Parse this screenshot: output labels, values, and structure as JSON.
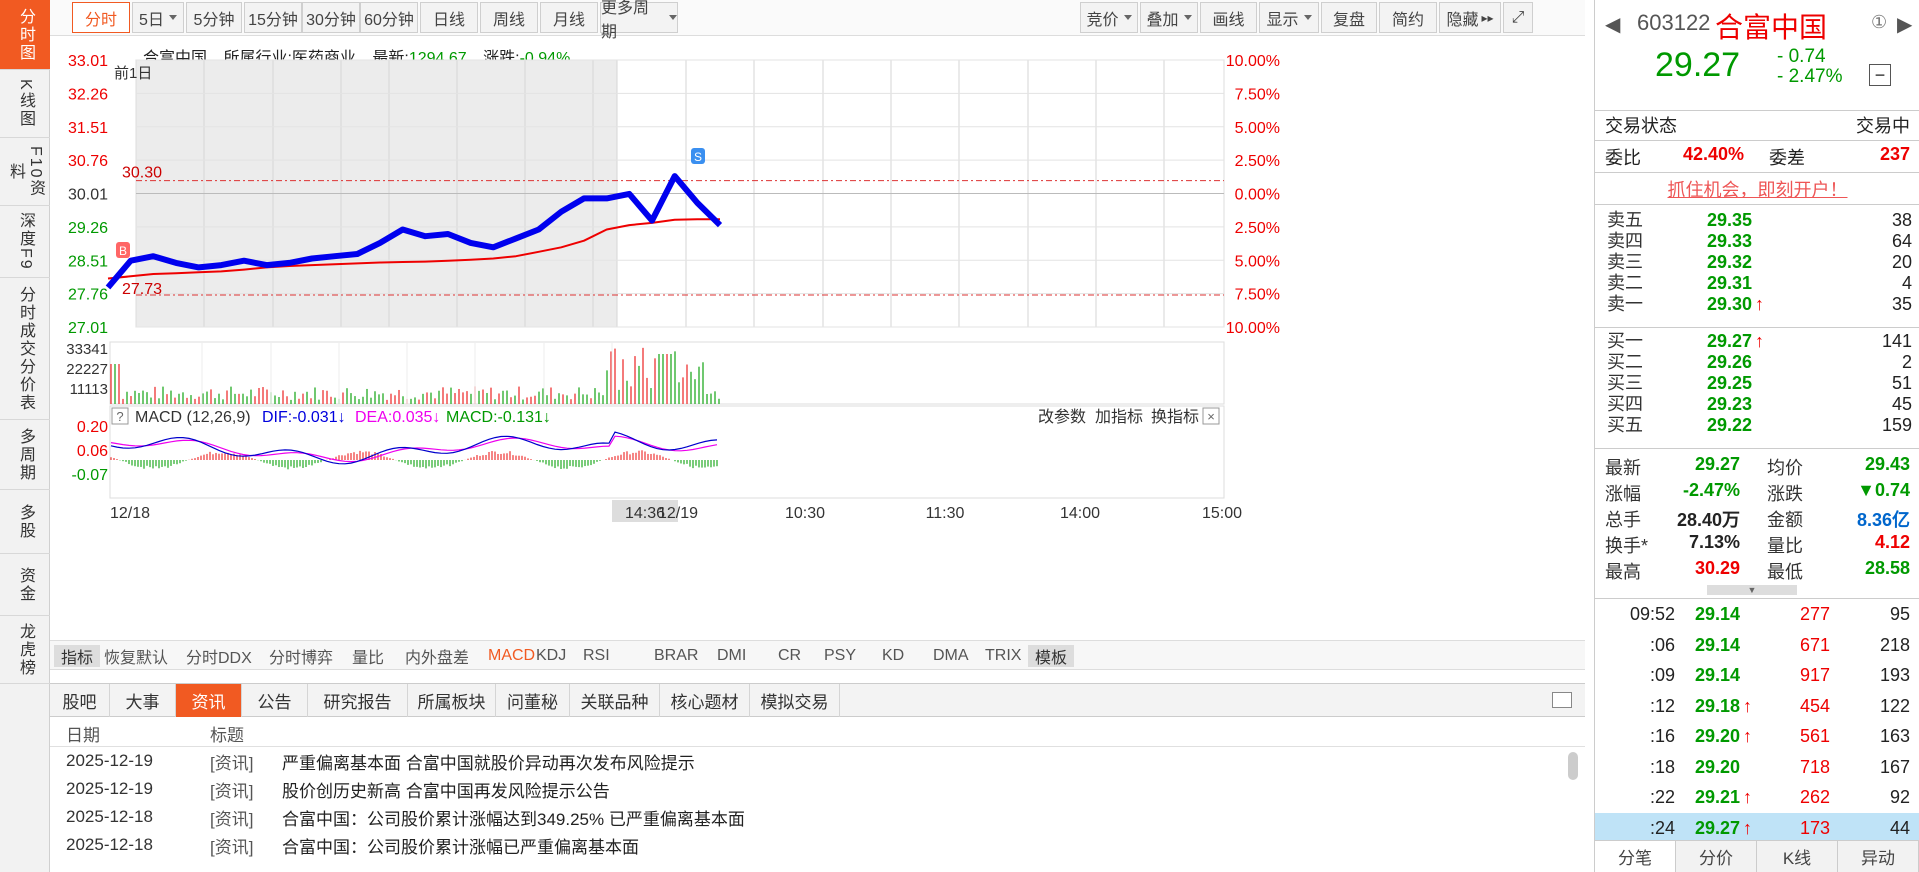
{
  "left_nav": [
    {
      "label": "分时图",
      "active": true
    },
    {
      "label": "K线图",
      "active": false
    },
    {
      "label": "F10资料",
      "active": false
    },
    {
      "label": "深度F9",
      "active": false
    },
    {
      "label": "分时成交分价表",
      "active": false
    },
    {
      "label": "多周期",
      "active": false
    },
    {
      "label": "多股",
      "active": false
    },
    {
      "label": "资金",
      "active": false
    },
    {
      "label": "龙虎榜",
      "active": false
    }
  ],
  "toolbar": {
    "period_buttons": [
      "分时",
      "5日",
      "5分钟",
      "15分钟",
      "30分钟",
      "60分钟",
      "日线",
      "周线",
      "月线",
      "更多周期"
    ],
    "right_buttons": [
      "竞价",
      "叠加",
      "画线",
      "显示",
      "复盘",
      "简约",
      "隐藏"
    ]
  },
  "info": {
    "name": "合富中国",
    "industry_label": "所属行业:",
    "industry": "医药商业",
    "latest_label": "最新:",
    "latest": "1294.67",
    "change_label": "涨跌:",
    "change": "-0.94%"
  },
  "price_chart": {
    "prev_label": "前1日",
    "y_ticks": [
      "33.01",
      "32.26",
      "31.51",
      "30.76",
      "30.01",
      "29.26",
      "28.51",
      "27.76",
      "27.01"
    ],
    "pct_ticks": [
      "10.00%",
      "7.50%",
      "5.00%",
      "2.50%",
      "0.00%",
      "2.50%",
      "5.00%",
      "7.50%",
      "10.00%"
    ],
    "high_marker": "30.30",
    "low_marker": "27.73",
    "buy_mark": "B",
    "sell_mark": "S"
  },
  "chart_data": {
    "type": "line",
    "title": "",
    "x_labels": [
      "12/18",
      "14:36",
      "12/19",
      "10:30",
      "11:30",
      "14:00",
      "15:00"
    ],
    "ylim": [
      27.01,
      33.01
    ],
    "prev_close": 30.01,
    "series": [
      {
        "name": "",
        "values": [
          27.9,
          28.5,
          28.6,
          28.45,
          28.35,
          28.4,
          28.5,
          28.4,
          28.45,
          28.55,
          28.6,
          28.65,
          28.9,
          29.2,
          29.05,
          29.1,
          28.9,
          28.8,
          29.0,
          29.2,
          29.6,
          29.9,
          29.9,
          30.0,
          29.4,
          30.4,
          29.8,
          29.3
        ]
      },
      {
        "name": "",
        "values": [
          28.1,
          28.15,
          28.2,
          28.22,
          28.24,
          28.26,
          28.3,
          28.35,
          28.38,
          28.4,
          28.42,
          28.44,
          28.46,
          28.47,
          28.48,
          28.5,
          28.52,
          28.55,
          28.6,
          28.7,
          28.8,
          28.95,
          29.2,
          29.3,
          29.35,
          29.42,
          29.43,
          29.43
        ]
      }
    ],
    "volume": {
      "y_ticks": [
        "33341",
        "22227",
        "11113"
      ]
    },
    "macd": {
      "title": "MACD (12,26,9)",
      "dif": "DIF:-0.031↓",
      "dea": "DEA:0.035↓",
      "macd": "MACD:-0.131↓",
      "y_ticks": [
        "0.20",
        "0.06",
        "-0.07"
      ],
      "buttons": [
        "改参数",
        "加指标",
        "换指标"
      ]
    }
  },
  "indicator_tabs": [
    "指标",
    "恢复默认",
    "分时DDX",
    "分时博弈",
    "量比",
    "内外盘差",
    "MACD",
    "KDJ",
    "RSI",
    "BRAR",
    "DMI",
    "CR",
    "PSY",
    "KD",
    "DMA",
    "TRIX",
    "模板"
  ],
  "news_tabs": [
    "股吧",
    "大事",
    "资讯",
    "公告",
    "研究报告",
    "所属板块",
    "问董秘",
    "关联品种",
    "核心题材",
    "模拟交易"
  ],
  "news_header": {
    "date": "日期",
    "title": "标题"
  },
  "news": [
    {
      "date": "2025-12-19",
      "tag": "[资讯]",
      "title": "严重偏离基本面 合富中国就股价异动再次发布风险提示"
    },
    {
      "date": "2025-12-19",
      "tag": "[资讯]",
      "title": "股价创历史新高 合富中国再发风险提示公告"
    },
    {
      "date": "2025-12-18",
      "tag": "[资讯]",
      "title": "合富中国：公司股价累计涨幅达到349.25% 已严重偏离基本面"
    },
    {
      "date": "2025-12-18",
      "tag": "[资讯]",
      "title": "合富中国：公司股价累计涨幅已严重偏离基本面"
    }
  ],
  "quote": {
    "code": "603122",
    "name": "合富中国",
    "price": "29.27",
    "change": "- 0.74",
    "change_pct": "- 2.47%",
    "status_label": "交易状态",
    "status": "交易中",
    "wb_label": "委比",
    "wb": "42.40%",
    "wc_label": "委差",
    "wc": "237",
    "promo": "抓住机会，即刻开户！",
    "sell": [
      {
        "label": "卖五",
        "price": "29.35",
        "vol": "38"
      },
      {
        "label": "卖四",
        "price": "29.33",
        "vol": "64"
      },
      {
        "label": "卖三",
        "price": "29.32",
        "vol": "20"
      },
      {
        "label": "卖二",
        "price": "29.31",
        "vol": "4"
      },
      {
        "label": "卖一",
        "price": "29.30",
        "vol": "35",
        "up": true
      }
    ],
    "buy": [
      {
        "label": "买一",
        "price": "29.27",
        "vol": "141",
        "up": true
      },
      {
        "label": "买二",
        "price": "29.26",
        "vol": "2"
      },
      {
        "label": "买三",
        "price": "29.25",
        "vol": "51"
      },
      {
        "label": "买四",
        "price": "29.23",
        "vol": "45"
      },
      {
        "label": "买五",
        "price": "29.22",
        "vol": "159"
      }
    ],
    "stats": [
      {
        "l1": "最新",
        "v1": "29.27",
        "c1": "green",
        "l2": "均价",
        "v2": "29.43",
        "c2": "green"
      },
      {
        "l1": "涨幅",
        "v1": "-2.47%",
        "c1": "green",
        "l2": "涨跌",
        "v2": "▼0.74",
        "c2": "green"
      },
      {
        "l1": "总手",
        "v1": "28.40万",
        "c1": "dark",
        "l2": "金额",
        "v2": "8.36亿",
        "c2": "blue"
      },
      {
        "l1": "换手*",
        "v1": "7.13%",
        "c1": "dark",
        "l2": "量比",
        "v2": "4.12",
        "c2": "red"
      },
      {
        "l1": "最高",
        "v1": "30.29",
        "c1": "red",
        "l2": "最低",
        "v2": "28.58",
        "c2": "green"
      }
    ],
    "ticks": [
      {
        "t": "09:52",
        "p": "29.14",
        "v": "277",
        "n": "95"
      },
      {
        "t": ":06",
        "p": "29.14",
        "v": "671",
        "n": "218"
      },
      {
        "t": ":09",
        "p": "29.14",
        "v": "917",
        "n": "193"
      },
      {
        "t": ":12",
        "p": "29.18",
        "v": "454",
        "n": "122",
        "up": true
      },
      {
        "t": ":16",
        "p": "29.20",
        "v": "561",
        "n": "163",
        "up": true
      },
      {
        "t": ":18",
        "p": "29.20",
        "v": "718",
        "n": "167"
      },
      {
        "t": ":22",
        "p": "29.21",
        "v": "262",
        "n": "92",
        "up": true
      },
      {
        "t": ":24",
        "p": "29.27",
        "v": "173",
        "n": "44",
        "up": true,
        "hl": true
      }
    ],
    "bottom_tabs": [
      "分笔",
      "分价",
      "K线",
      "异动"
    ]
  }
}
